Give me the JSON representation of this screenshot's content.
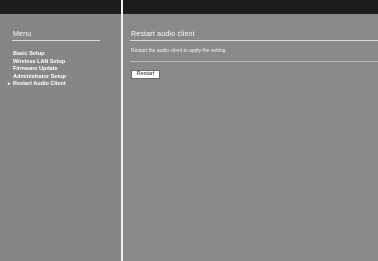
{
  "sidebar": {
    "heading": "Menu",
    "items": [
      {
        "label": "Basic Setup",
        "active": false
      },
      {
        "label": "Wireless LAN Setup",
        "active": false
      },
      {
        "label": "Firmware Update",
        "active": false
      },
      {
        "label": "Administrator Setup",
        "active": false
      },
      {
        "label": "Restart Audio Client",
        "active": true,
        "marker": "▸"
      }
    ]
  },
  "main": {
    "title": "Restart audio client",
    "description": "Restart the audio client to apply the setting",
    "restart_button": "Restart"
  },
  "colors": {
    "topbar": "#1c1c1c",
    "background": "#898989",
    "text": "#ffffff",
    "divider": "#f2f2f2"
  }
}
